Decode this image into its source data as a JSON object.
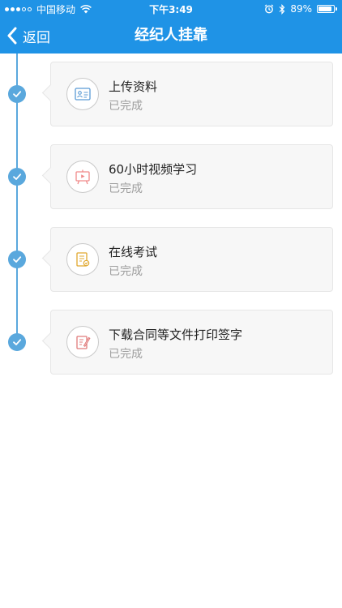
{
  "status_bar": {
    "carrier": "中国移动",
    "time": "下午3:49",
    "battery_percent": "89%",
    "battery_level": 0.89,
    "icons": [
      "signal-dots",
      "wifi-icon",
      "alarm-icon",
      "bluetooth-icon",
      "battery-icon"
    ]
  },
  "nav": {
    "back_label": "返回",
    "title": "经纪人挂靠",
    "back_icon": "chevron-left-icon"
  },
  "colors": {
    "header_bg": "#1f93e6",
    "timeline": "#5aa8dd",
    "card_bg": "#f7f7f7",
    "status_text": "#9e9e9e"
  },
  "steps": [
    {
      "title": "上传资料",
      "status": "已完成",
      "icon": "id-card-icon",
      "icon_color": "#5b9bd5"
    },
    {
      "title": "60小时视频学习",
      "status": "已完成",
      "icon": "video-board-icon",
      "icon_color": "#f08a8a"
    },
    {
      "title": "在线考试",
      "status": "已完成",
      "icon": "exam-paper-icon",
      "icon_color": "#e0a82e"
    },
    {
      "title": "下载合同等文件打印签字",
      "status": "已完成",
      "icon": "sign-document-icon",
      "icon_color": "#e07b7b"
    }
  ]
}
